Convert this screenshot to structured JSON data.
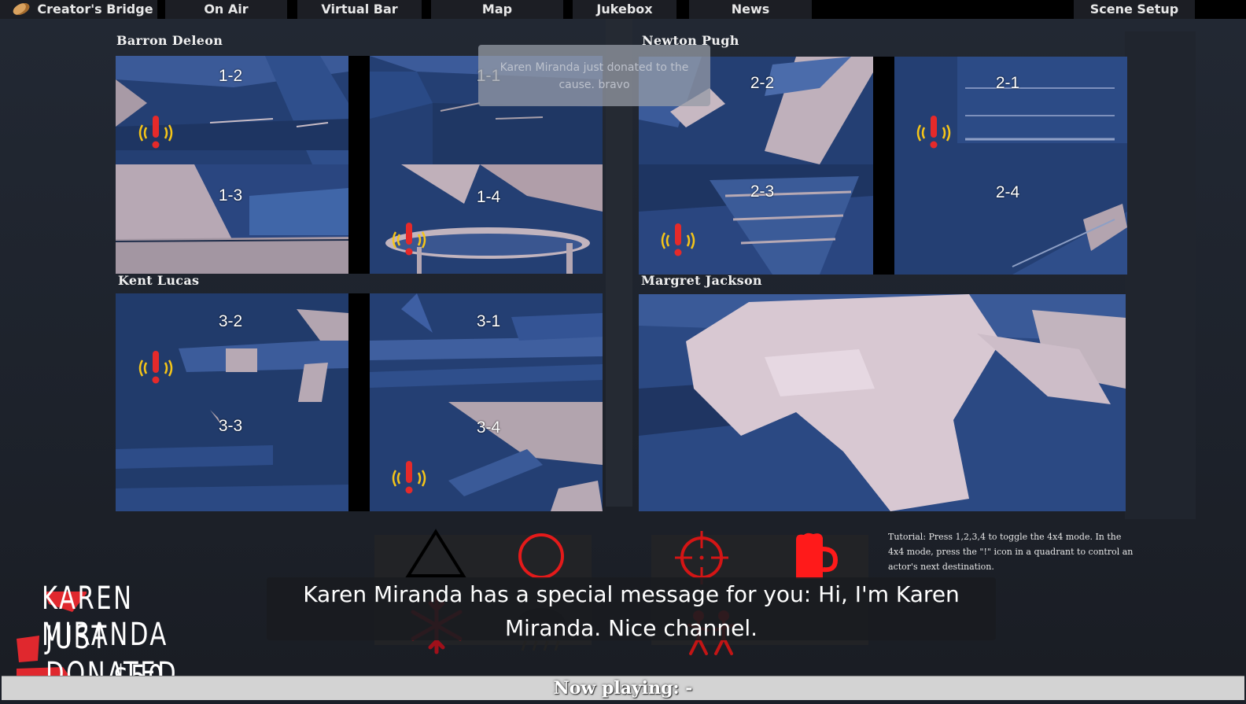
{
  "topbar": {
    "tabs": [
      {
        "label": "Creator's Bridge"
      },
      {
        "label": "On Air"
      },
      {
        "label": "Virtual Bar"
      },
      {
        "label": "Map"
      },
      {
        "label": "Jukebox"
      },
      {
        "label": "News"
      },
      {
        "label": "Scene Setup"
      }
    ]
  },
  "groups": [
    {
      "name": "Barron Deleon",
      "cams": [
        "1-2",
        "1-1",
        "1-3",
        "1-4"
      ]
    },
    {
      "name": "Newton Pugh",
      "cams": [
        "2-2",
        "2-1",
        "2-3",
        "2-4"
      ]
    },
    {
      "name": "Kent Lucas",
      "cams": [
        "3-2",
        "3-1",
        "3-3",
        "3-4"
      ]
    },
    {
      "name": "Margret Jackson",
      "cams": []
    }
  ],
  "notification": {
    "text": "Karen Miranda just donated to the cause. bravo"
  },
  "actions": {
    "icons": [
      "triangle-icon",
      "circle-icon",
      "crosshair-icon",
      "beer-mug-icon",
      "snowflake-icon",
      "rain-cloud-icon",
      "dancing-people-icon"
    ],
    "accent_color": "#ff1a1a"
  },
  "tutorial": {
    "text": "Tutorial: Press 1,2,3,4 to toggle the 4x4 mode. In the 4x4 mode, press the \"!\" icon in a quadrant to control an actor's next destination."
  },
  "subtitle": {
    "text": "Karen Miranda has a special message for you: Hi, I'm Karen Miranda. Nice channel."
  },
  "donation": {
    "line1": "KAREN MIRANDA",
    "line2": "JUST DONATED",
    "line3": "$50."
  },
  "now_playing": {
    "text": "Now playing: -"
  }
}
